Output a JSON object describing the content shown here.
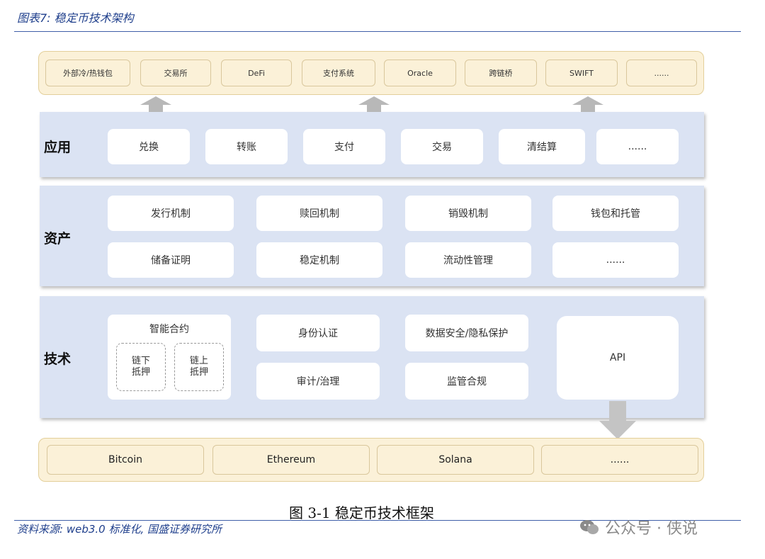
{
  "header": {
    "title": "图表7: 稳定币技术架构"
  },
  "top_row": [
    "外部冷/热钱包",
    "交易所",
    "DeFi",
    "支付系统",
    "Oracle",
    "跨链桥",
    "SWIFT",
    "......"
  ],
  "layers": {
    "application": {
      "label": "应用",
      "items": [
        "兑换",
        "转账",
        "支付",
        "交易",
        "清结算",
        "......"
      ]
    },
    "asset": {
      "label": "资产",
      "row1": [
        "发行机制",
        "赎回机制",
        "销毁机制",
        "钱包和托管"
      ],
      "row2": [
        "储备证明",
        "稳定机制",
        "流动性管理",
        "......"
      ]
    },
    "tech": {
      "label": "技术",
      "smart_contract": {
        "title": "智能合约",
        "offchain": "链下\n抵押",
        "onchain": "链上\n抵押"
      },
      "col2": [
        "身份认证",
        "审计/治理"
      ],
      "col3": [
        "数据安全/隐私保护",
        "监管合规"
      ],
      "api": "API"
    }
  },
  "bottom_row": [
    "Bitcoin",
    "Ethereum",
    "Solana",
    "......"
  ],
  "caption": "图 3-1  稳定币技术框架",
  "source": "资料来源: web3.0 标准化, 国盛证券研究所",
  "watermark": "公众号 · 侠说",
  "colors": {
    "layer_bg": "#dbe3f3",
    "band_bg": "#fbf1d8",
    "heading_blue": "#1f3f8c"
  }
}
